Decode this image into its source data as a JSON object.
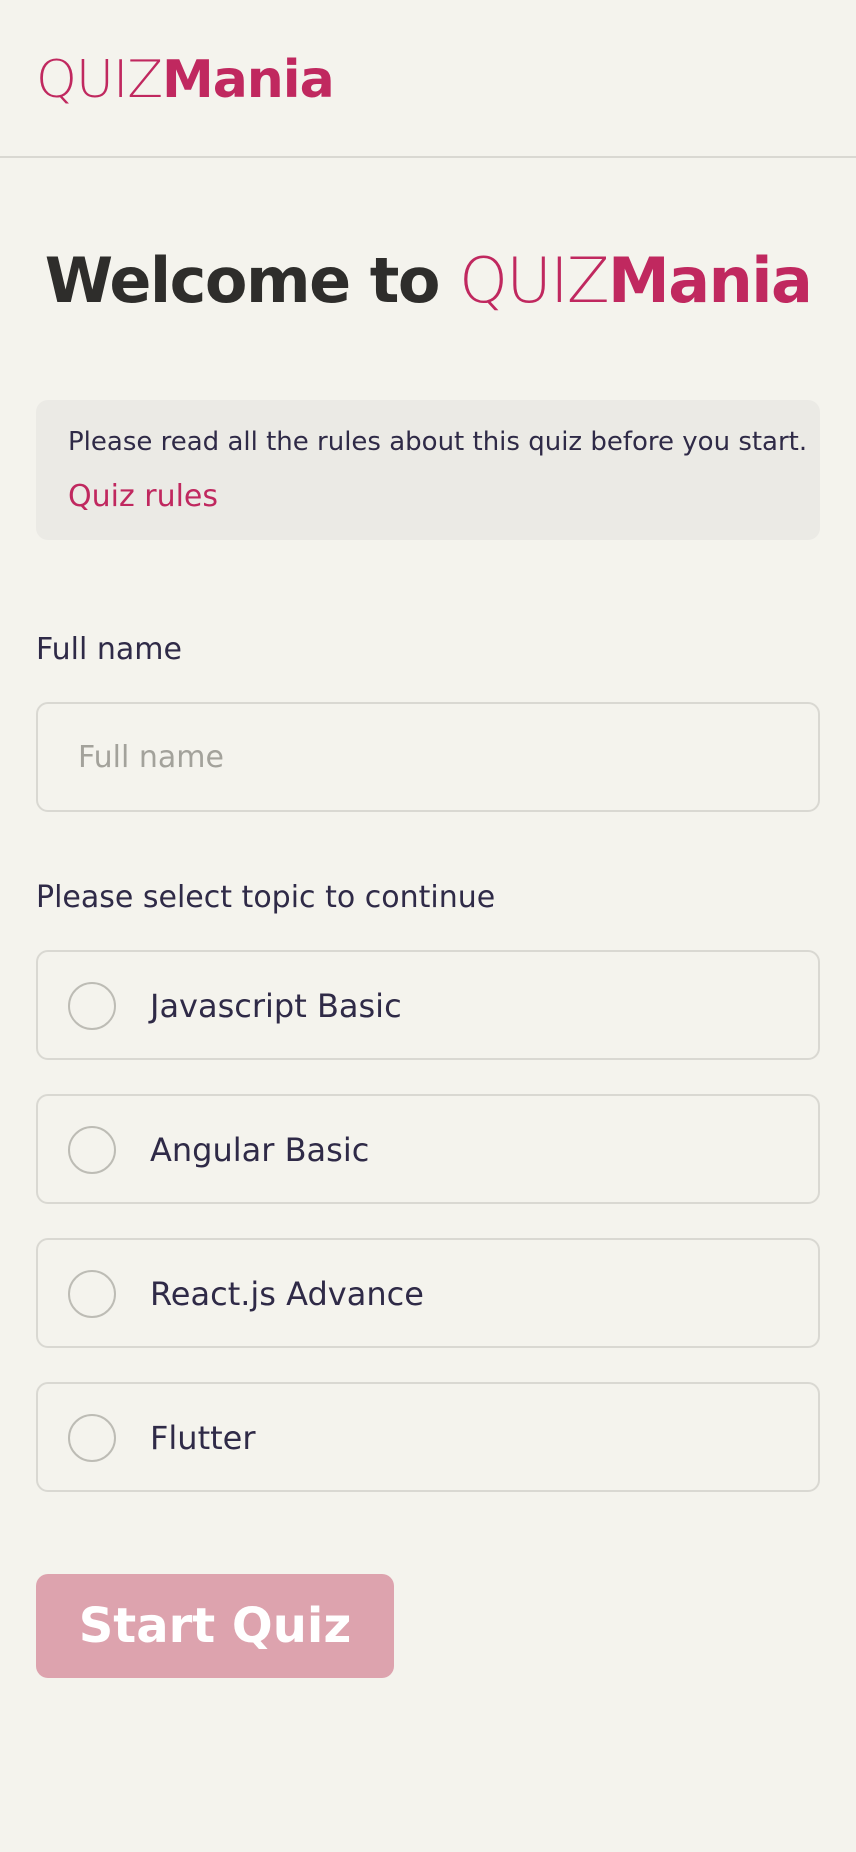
{
  "header": {
    "logo_light": "QUIZ",
    "logo_bold": "Mania"
  },
  "welcome": {
    "prefix": "Welcome to ",
    "brand_light": "QUIZ",
    "brand_bold": "Mania"
  },
  "rules": {
    "text": "Please read all the rules about this quiz before you start.",
    "link_label": "Quiz rules"
  },
  "form": {
    "name_label": "Full name",
    "name_placeholder": "Full name",
    "name_value": "",
    "topic_label": "Please select topic to continue",
    "topics": [
      {
        "label": "Javascript Basic",
        "selected": false
      },
      {
        "label": "Angular Basic",
        "selected": false
      },
      {
        "label": "React.js Advance",
        "selected": false
      },
      {
        "label": "Flutter",
        "selected": false
      }
    ],
    "start_label": "Start Quiz"
  },
  "colors": {
    "brand": "#c0285f",
    "background": "#f4f3ed",
    "button_disabled": "#dda3ae",
    "text": "#2f2a47"
  }
}
